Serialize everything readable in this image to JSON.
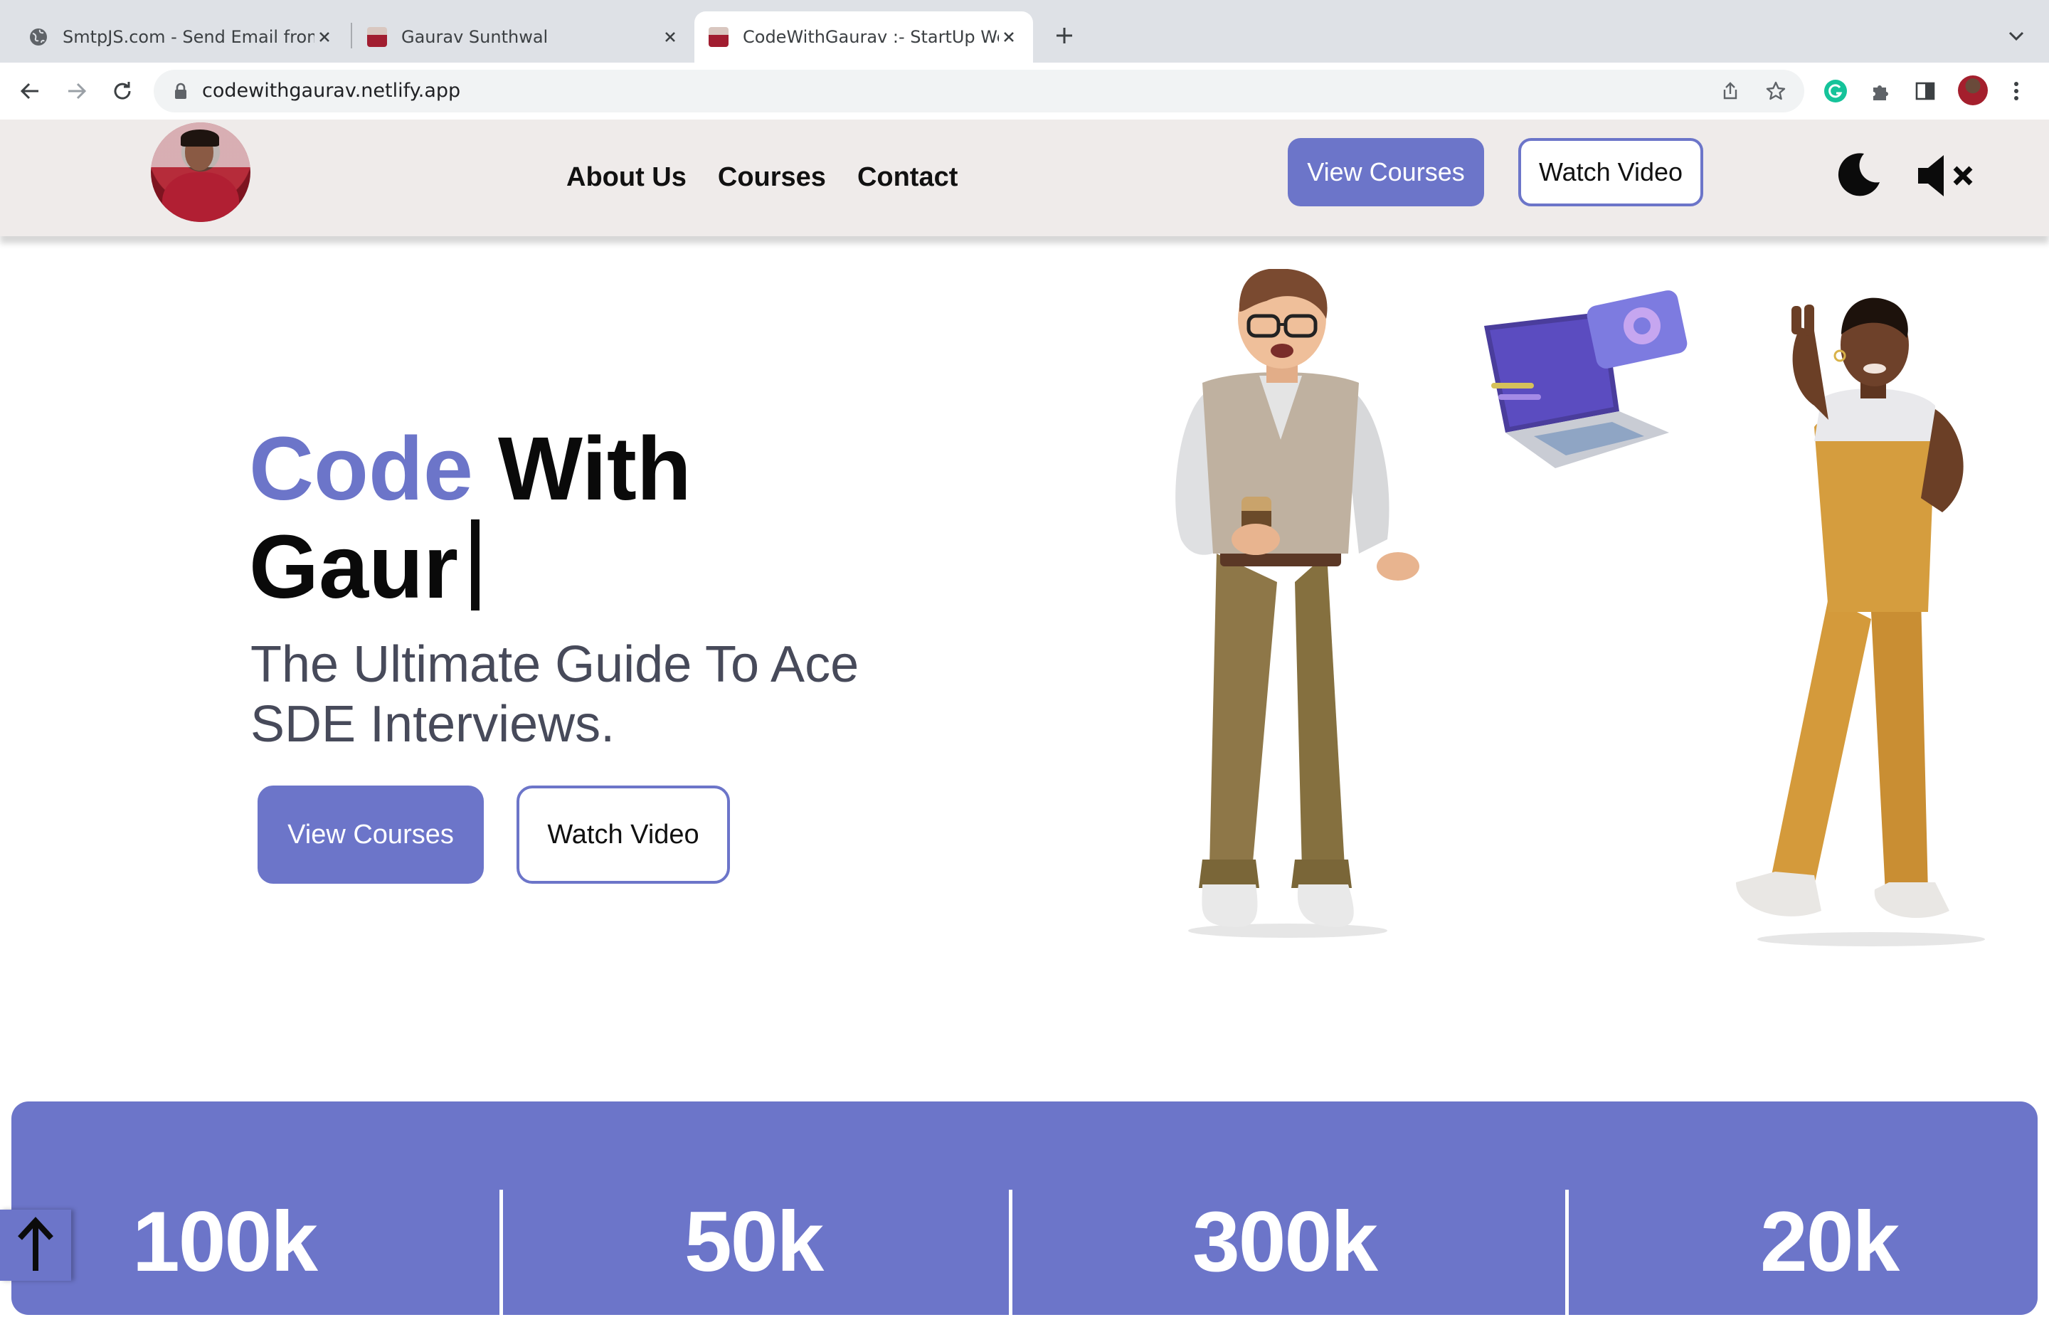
{
  "browser": {
    "tabs": [
      {
        "title": "SmtpJS.com - Send Email from",
        "active": false
      },
      {
        "title": "Gaurav Sunthwal",
        "active": false
      },
      {
        "title": "CodeWithGaurav :- StartUp We",
        "active": true
      }
    ],
    "url": "codewithgaurav.netlify.app"
  },
  "site": {
    "nav": {
      "links": [
        "About Us",
        "Courses",
        "Contact"
      ],
      "view_courses": "View Courses",
      "watch_video": "Watch Video"
    },
    "hero": {
      "title_accent": "Code",
      "title_rest": " With",
      "title_line2": "Gaur",
      "subtitle": "The Ultimate Guide To Ace SDE Interviews.",
      "view_courses": "View Courses",
      "watch_video": "Watch Video"
    },
    "stats": [
      "100k",
      "50k",
      "300k",
      "20k"
    ]
  },
  "colors": {
    "accent": "#6c75c9",
    "nav_bg": "#efebea"
  },
  "icons": [
    "globe-icon",
    "close-icon",
    "plus-icon",
    "chevron-down-icon",
    "back-arrow-icon",
    "forward-arrow-icon",
    "reload-icon",
    "lock-icon",
    "share-icon",
    "star-icon",
    "grammarly-icon",
    "puzzle-icon",
    "sidebar-icon",
    "kebab-menu-icon",
    "moon-icon",
    "mute-icon",
    "arrow-up-icon"
  ]
}
